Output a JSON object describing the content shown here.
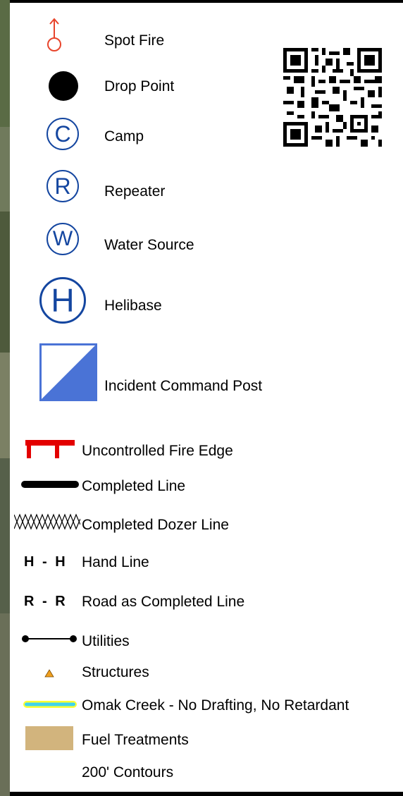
{
  "legend": {
    "items": [
      {
        "key": "spot_fire",
        "label": "Spot Fire"
      },
      {
        "key": "drop_point",
        "label": "Drop Point"
      },
      {
        "key": "camp",
        "label": "Camp",
        "glyph": "C"
      },
      {
        "key": "repeater",
        "label": "Repeater",
        "glyph": "R"
      },
      {
        "key": "water_source",
        "label": "Water Source",
        "glyph": "W"
      },
      {
        "key": "helibase",
        "label": "Helibase",
        "glyph": "H"
      },
      {
        "key": "icp",
        "label": "Incident Command Post"
      },
      {
        "key": "uncontrolled_edge",
        "label": "Uncontrolled Fire Edge"
      },
      {
        "key": "completed_line",
        "label": "Completed Line"
      },
      {
        "key": "dozer_line",
        "label": "Completed Dozer Line"
      },
      {
        "key": "hand_line",
        "label": "Hand Line",
        "glyph": "H - H"
      },
      {
        "key": "road_line",
        "label": "Road as Completed Line",
        "glyph": "R - R"
      },
      {
        "key": "utilities",
        "label": "Utilities"
      },
      {
        "key": "structures",
        "label": "Structures"
      },
      {
        "key": "omak_creek",
        "label": "Omak Creek - No Drafting, No Retardant"
      },
      {
        "key": "fuel_treatments",
        "label": "Fuel Treatments"
      },
      {
        "key": "contours",
        "label": "200' Contours"
      }
    ]
  },
  "colors": {
    "spot_fire": "#e8452c",
    "fire_edge": "#e30000",
    "symbol_blue": "#1446a0",
    "icp_blue": "#4a73d6",
    "structure": "#f0a020",
    "creek_core": "#3fd4ec",
    "creek_halo": "#ffff33",
    "fuel": "#d2b47d"
  },
  "icons": {
    "qr": "qr-code-icon"
  }
}
